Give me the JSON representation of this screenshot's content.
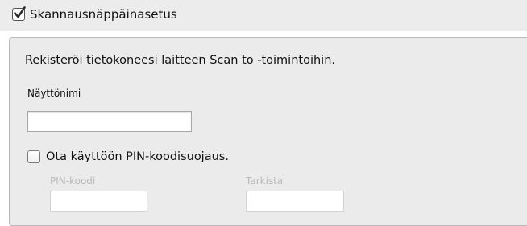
{
  "header": {
    "checkbox_checked": true,
    "title": "Skannausnäppäinasetus"
  },
  "panel": {
    "description": "Rekisteröi tietokoneesi laitteen Scan to -toimintoihin.",
    "display_name": {
      "label": "Näyttönimi",
      "value": ""
    },
    "pin_protection": {
      "checked": false,
      "label": "Ota käyttöön PIN-koodisuojaus.",
      "pin_label": "PIN-koodi",
      "pin_value": "",
      "verify_label": "Tarkista",
      "verify_value": ""
    }
  }
}
